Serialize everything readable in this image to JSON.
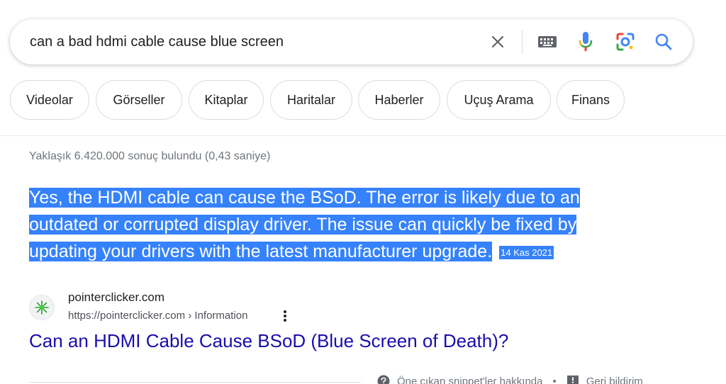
{
  "search": {
    "query": "can a bad hdmi cable cause blue screen"
  },
  "chips": [
    {
      "label": "Videolar"
    },
    {
      "label": "Görseller"
    },
    {
      "label": "Kitaplar"
    },
    {
      "label": "Haritalar"
    },
    {
      "label": "Haberler"
    },
    {
      "label": "Uçuş Arama"
    },
    {
      "label": "Finans"
    }
  ],
  "results": {
    "stats": "Yaklaşık 6.420.000 sonuç bulundu (0,43 saniye)"
  },
  "snippet": {
    "line1": "Yes, the HDMI cable can cause the BSoD. The error is likely due to an",
    "line2": "outdated or corrupted display driver. The issue can quickly be fixed by",
    "line3": "updating your drivers with the latest manufacturer upgrade.",
    "date": "14 Kas 2021"
  },
  "result": {
    "site_name": "pointerclicker.com",
    "url": "https://pointerclicker.com › Information",
    "title": "Can an HDMI Cable Cause BSoD (Blue Screen of Death)?"
  },
  "footer": {
    "about_snippets": "Öne çıkan snippet'ler hakkında",
    "separator": "•",
    "feedback": "Geri bildirim"
  },
  "colors": {
    "link": "#1a0dab",
    "selection": "#3582fc",
    "google_blue": "#4285f4",
    "google_red": "#ea4335",
    "google_yellow": "#fbbc05",
    "google_green": "#34a853"
  },
  "icons": {
    "clear": "close-icon",
    "keyboard": "keyboard-icon",
    "mic": "microphone-icon",
    "lens": "google-lens-icon",
    "search": "search-icon",
    "favicon": "site-favicon-icon",
    "more": "more-vert-icon",
    "help": "help-circle-icon",
    "feedback": "feedback-icon"
  }
}
